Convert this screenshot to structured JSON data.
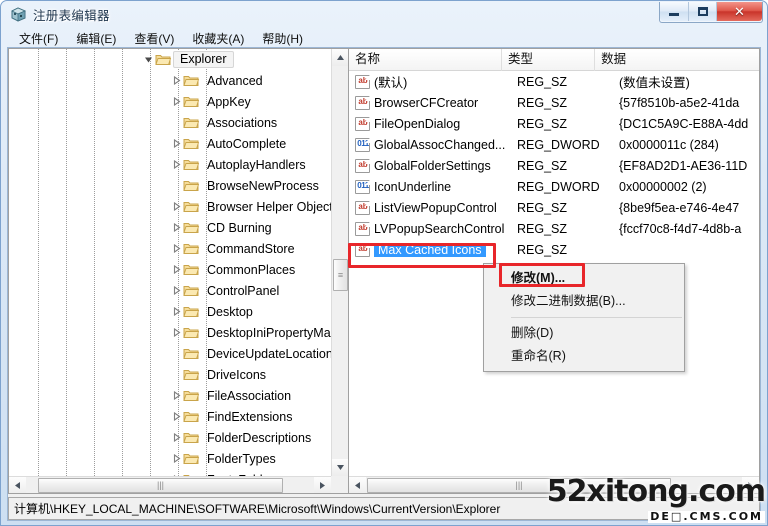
{
  "window": {
    "title": "注册表编辑器",
    "icon": "regedit-icon",
    "buttons": {
      "minimize": "minimize-icon",
      "maximize": "maximize-icon",
      "close": "close-icon"
    }
  },
  "menubar": {
    "items": [
      {
        "label": "文件(F)",
        "name": "menu-file"
      },
      {
        "label": "编辑(E)",
        "name": "menu-edit"
      },
      {
        "label": "查看(V)",
        "name": "menu-view"
      },
      {
        "label": "收藏夹(A)",
        "name": "menu-favorites"
      },
      {
        "label": "帮助(H)",
        "name": "menu-help"
      }
    ]
  },
  "tree": {
    "rows": [
      {
        "label": "Explorer",
        "indent": 0,
        "expander": "expanded",
        "selected": true
      },
      {
        "label": "Advanced",
        "indent": 1,
        "expander": "collapsed",
        "selected": false
      },
      {
        "label": "AppKey",
        "indent": 1,
        "expander": "collapsed",
        "selected": false
      },
      {
        "label": "Associations",
        "indent": 1,
        "expander": "none",
        "selected": false
      },
      {
        "label": "AutoComplete",
        "indent": 1,
        "expander": "collapsed",
        "selected": false
      },
      {
        "label": "AutoplayHandlers",
        "indent": 1,
        "expander": "collapsed",
        "selected": false
      },
      {
        "label": "BrowseNewProcess",
        "indent": 1,
        "expander": "none",
        "selected": false
      },
      {
        "label": "Browser Helper Objects",
        "indent": 1,
        "expander": "collapsed",
        "selected": false
      },
      {
        "label": "CD Burning",
        "indent": 1,
        "expander": "collapsed",
        "selected": false
      },
      {
        "label": "CommandStore",
        "indent": 1,
        "expander": "collapsed",
        "selected": false
      },
      {
        "label": "CommonPlaces",
        "indent": 1,
        "expander": "collapsed",
        "selected": false
      },
      {
        "label": "ControlPanel",
        "indent": 1,
        "expander": "collapsed",
        "selected": false
      },
      {
        "label": "Desktop",
        "indent": 1,
        "expander": "collapsed",
        "selected": false
      },
      {
        "label": "DesktopIniPropertyMap",
        "indent": 1,
        "expander": "collapsed",
        "selected": false
      },
      {
        "label": "DeviceUpdateLocations",
        "indent": 1,
        "expander": "none",
        "selected": false
      },
      {
        "label": "DriveIcons",
        "indent": 1,
        "expander": "none",
        "selected": false
      },
      {
        "label": "FileAssociation",
        "indent": 1,
        "expander": "collapsed",
        "selected": false
      },
      {
        "label": "FindExtensions",
        "indent": 1,
        "expander": "collapsed",
        "selected": false
      },
      {
        "label": "FolderDescriptions",
        "indent": 1,
        "expander": "collapsed",
        "selected": false
      },
      {
        "label": "FolderTypes",
        "indent": 1,
        "expander": "collapsed",
        "selected": false
      },
      {
        "label": "FontsFolder",
        "indent": 1,
        "expander": "collapsed",
        "selected": false
      }
    ]
  },
  "list": {
    "columns": [
      {
        "label": "名称",
        "name": "column-name"
      },
      {
        "label": "类型",
        "name": "column-type"
      },
      {
        "label": "数据",
        "name": "column-data"
      }
    ],
    "rows": [
      {
        "icon": "string-value-icon",
        "name": "(默认)",
        "type": "REG_SZ",
        "data": "(数值未设置)",
        "selected": false
      },
      {
        "icon": "string-value-icon",
        "name": "BrowserCFCreator",
        "type": "REG_SZ",
        "data": "{57f8510b-a5e2-41da",
        "selected": false
      },
      {
        "icon": "string-value-icon",
        "name": "FileOpenDialog",
        "type": "REG_SZ",
        "data": "{DC1C5A9C-E88A-4dd",
        "selected": false
      },
      {
        "icon": "dword-value-icon",
        "name": "GlobalAssocChanged...",
        "type": "REG_DWORD",
        "data": "0x0000011c (284)",
        "selected": false
      },
      {
        "icon": "string-value-icon",
        "name": "GlobalFolderSettings",
        "type": "REG_SZ",
        "data": "{EF8AD2D1-AE36-11D",
        "selected": false
      },
      {
        "icon": "dword-value-icon",
        "name": "IconUnderline",
        "type": "REG_DWORD",
        "data": "0x00000002 (2)",
        "selected": false
      },
      {
        "icon": "string-value-icon",
        "name": "ListViewPopupControl",
        "type": "REG_SZ",
        "data": "{8be9f5ea-e746-4e47",
        "selected": false
      },
      {
        "icon": "string-value-icon",
        "name": "LVPopupSearchControl",
        "type": "REG_SZ",
        "data": "{fccf70c8-f4d7-4d8b-a",
        "selected": false
      },
      {
        "icon": "string-value-icon",
        "name": "Max Cached Icons",
        "type": "REG_SZ",
        "data": "",
        "selected": true
      }
    ]
  },
  "context_menu": {
    "items": [
      {
        "label": "修改(M)...",
        "name": "ctx-modify",
        "bold": true,
        "separator_after": false
      },
      {
        "label": "修改二进制数据(B)...",
        "name": "ctx-modify-binary",
        "bold": false,
        "separator_after": true
      },
      {
        "label": "删除(D)",
        "name": "ctx-delete",
        "bold": false,
        "separator_after": false
      },
      {
        "label": "重命名(R)",
        "name": "ctx-rename",
        "bold": false,
        "separator_after": false
      }
    ]
  },
  "statusbar": {
    "path": "计算机\\HKEY_LOCAL_MACHINE\\SOFTWARE\\Microsoft\\Windows\\CurrentVersion\\Explorer"
  },
  "watermark": {
    "main": "52xitong.com",
    "sub": "DE□.CMS.COM"
  },
  "colors": {
    "selection": "#3399ff",
    "annotation": "#e8262a",
    "folder": "#fcd77a",
    "close_button": "#c9342a"
  }
}
